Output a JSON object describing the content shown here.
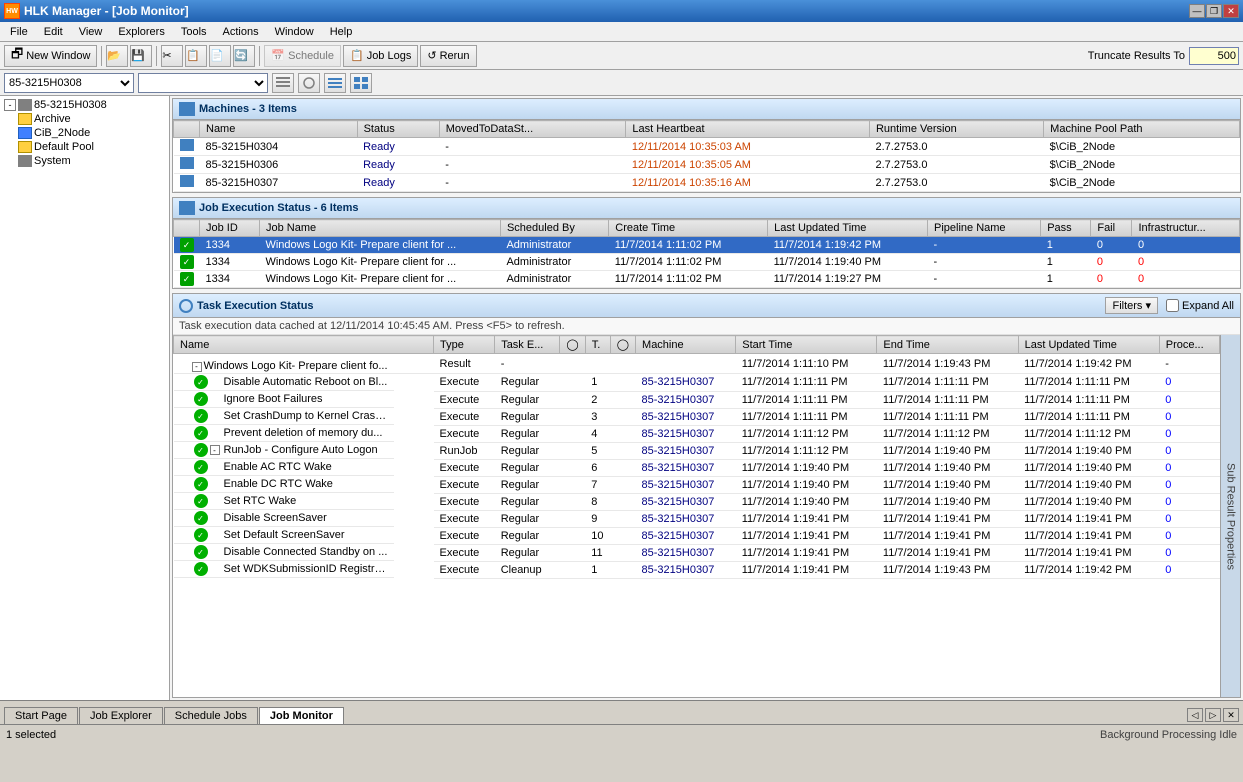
{
  "window": {
    "title": "HLK Manager - [Job Monitor]",
    "logo_text": "HW"
  },
  "title_buttons": [
    "—",
    "□",
    "✕"
  ],
  "menu": {
    "items": [
      "File",
      "Edit",
      "View",
      "Explorers",
      "Tools",
      "Actions",
      "Window",
      "Help"
    ]
  },
  "toolbar": {
    "new_window": "New Window",
    "schedule": "Schedule",
    "job_logs": "Job Logs",
    "rerun": "Rerun",
    "truncate_label": "Truncate Results To",
    "truncate_value": "500"
  },
  "addr_bar": {
    "machine_id": "85-3215H0308",
    "pool_value": ""
  },
  "sidebar": {
    "root_label": "85-3215H0308",
    "items": [
      {
        "label": "Archive",
        "type": "folder",
        "indent": 1
      },
      {
        "label": "CiB_2Node",
        "type": "folder-blue",
        "indent": 1
      },
      {
        "label": "Default Pool",
        "type": "folder",
        "indent": 1
      },
      {
        "label": "System",
        "type": "computer",
        "indent": 1
      }
    ]
  },
  "machines_section": {
    "title": "Machines - 3 Items",
    "columns": [
      "Name",
      "Status",
      "MovedToDataSt...",
      "Last Heartbeat",
      "Runtime Version",
      "Machine Pool Path"
    ],
    "rows": [
      {
        "name": "85-3215H0304",
        "status": "Ready",
        "moved": "-",
        "heartbeat": "12/11/2014 10:35:03 AM",
        "runtime": "2.7.2753.0",
        "pool_path": "$\\CiB_2Node"
      },
      {
        "name": "85-3215H0306",
        "status": "Ready",
        "moved": "-",
        "heartbeat": "12/11/2014 10:35:05 AM",
        "runtime": "2.7.2753.0",
        "pool_path": "$\\CiB_2Node"
      },
      {
        "name": "85-3215H0307",
        "status": "Ready",
        "moved": "-",
        "heartbeat": "12/11/2014 10:35:16 AM",
        "runtime": "2.7.2753.0",
        "pool_path": "$\\CiB_2Node"
      }
    ]
  },
  "jobs_section": {
    "title": "Job Execution Status - 6 Items",
    "columns": [
      "Job ID",
      "Job Name",
      "Scheduled By",
      "Create Time",
      "Last Updated Time",
      "Pipeline Name",
      "Pass",
      "Fail",
      "Infrastructur..."
    ],
    "rows": [
      {
        "selected": true,
        "id": "1334",
        "name": "Windows Logo Kit- Prepare client for ...",
        "scheduled_by": "Administrator",
        "create_time": "11/7/2014 1:11:02 PM",
        "updated_time": "11/7/2014 1:19:42 PM",
        "pipeline": "-",
        "pass": "1",
        "fail": "0",
        "infra": "0"
      },
      {
        "selected": false,
        "id": "1334",
        "name": "Windows Logo Kit- Prepare client for ...",
        "scheduled_by": "Administrator",
        "create_time": "11/7/2014 1:11:02 PM",
        "updated_time": "11/7/2014 1:19:40 PM",
        "pipeline": "-",
        "pass": "1",
        "fail": "0",
        "infra": "0"
      },
      {
        "selected": false,
        "id": "1334",
        "name": "Windows Logo Kit- Prepare client for ...",
        "scheduled_by": "Administrator",
        "create_time": "11/7/2014 1:11:02 PM",
        "updated_time": "11/7/2014 1:19:27 PM",
        "pipeline": "-",
        "pass": "1",
        "fail": "0",
        "infra": "0"
      }
    ]
  },
  "task_section": {
    "title": "Task Execution Status",
    "cache_info": "Task execution data cached at 12/11/2014 10:45:45 AM. Press <F5> to refresh.",
    "filters_label": "Filters ▾",
    "expand_all_label": "Expand All",
    "columns": [
      "Name",
      "Type",
      "Task E...",
      "◯",
      "T.",
      "◯",
      "Machine",
      "Start Time",
      "End Time",
      "Last Updated Time",
      "Proce..."
    ],
    "rows": [
      {
        "indent": 0,
        "expand": true,
        "icon": "folder",
        "name": "Windows Logo Kit- Prepare client fo...",
        "type": "Result",
        "task_e": "-",
        "col1": "",
        "t": "",
        "col2": "",
        "machine": "",
        "start": "11/7/2014 1:11:10 PM",
        "end": "11/7/2014 1:19:43 PM",
        "updated": "11/7/2014 1:19:42 PM",
        "proc": "-"
      },
      {
        "indent": 1,
        "icon": "green",
        "name": "Disable Automatic Reboot on Bl...",
        "type": "Execute",
        "task_e": "Regular",
        "col1": "",
        "t": "1",
        "col2": "",
        "machine": "85-3215H0307",
        "start": "11/7/2014 1:11:11 PM",
        "end": "11/7/2014 1:11:11 PM",
        "updated": "11/7/2014 1:11:11 PM",
        "proc": "0"
      },
      {
        "indent": 1,
        "icon": "green",
        "name": "Ignore Boot Failures",
        "type": "Execute",
        "task_e": "Regular",
        "col1": "",
        "t": "2",
        "col2": "",
        "machine": "85-3215H0307",
        "start": "11/7/2014 1:11:11 PM",
        "end": "11/7/2014 1:11:11 PM",
        "updated": "11/7/2014 1:11:11 PM",
        "proc": "0"
      },
      {
        "indent": 1,
        "icon": "green",
        "name": "Set CrashDump to Kernel Crash...",
        "type": "Execute",
        "task_e": "Regular",
        "col1": "",
        "t": "3",
        "col2": "",
        "machine": "85-3215H0307",
        "start": "11/7/2014 1:11:11 PM",
        "end": "11/7/2014 1:11:11 PM",
        "updated": "11/7/2014 1:11:11 PM",
        "proc": "0"
      },
      {
        "indent": 1,
        "icon": "green",
        "name": "Prevent deletion of memory du...",
        "type": "Execute",
        "task_e": "Regular",
        "col1": "",
        "t": "4",
        "col2": "",
        "machine": "85-3215H0307",
        "start": "11/7/2014 1:11:12 PM",
        "end": "11/7/2014 1:11:12 PM",
        "updated": "11/7/2014 1:11:12 PM",
        "proc": "0"
      },
      {
        "indent": 1,
        "icon": "green",
        "expand": true,
        "name": "RunJob - Configure Auto Logon",
        "type": "RunJob",
        "task_e": "Regular",
        "col1": "",
        "t": "5",
        "col2": "",
        "machine": "85-3215H0307",
        "start": "11/7/2014 1:11:12 PM",
        "end": "11/7/2014 1:19:40 PM",
        "updated": "11/7/2014 1:19:40 PM",
        "proc": "0"
      },
      {
        "indent": 1,
        "icon": "green",
        "name": "Enable AC RTC Wake",
        "type": "Execute",
        "task_e": "Regular",
        "col1": "",
        "t": "6",
        "col2": "",
        "machine": "85-3215H0307",
        "start": "11/7/2014 1:19:40 PM",
        "end": "11/7/2014 1:19:40 PM",
        "updated": "11/7/2014 1:19:40 PM",
        "proc": "0"
      },
      {
        "indent": 1,
        "icon": "green",
        "name": "Enable DC RTC Wake",
        "type": "Execute",
        "task_e": "Regular",
        "col1": "",
        "t": "7",
        "col2": "",
        "machine": "85-3215H0307",
        "start": "11/7/2014 1:19:40 PM",
        "end": "11/7/2014 1:19:40 PM",
        "updated": "11/7/2014 1:19:40 PM",
        "proc": "0"
      },
      {
        "indent": 1,
        "icon": "green",
        "name": "Set RTC Wake",
        "type": "Execute",
        "task_e": "Regular",
        "col1": "",
        "t": "8",
        "col2": "",
        "machine": "85-3215H0307",
        "start": "11/7/2014 1:19:40 PM",
        "end": "11/7/2014 1:19:40 PM",
        "updated": "11/7/2014 1:19:40 PM",
        "proc": "0"
      },
      {
        "indent": 1,
        "icon": "green",
        "name": "Disable ScreenSaver",
        "type": "Execute",
        "task_e": "Regular",
        "col1": "",
        "t": "9",
        "col2": "",
        "machine": "85-3215H0307",
        "start": "11/7/2014 1:19:41 PM",
        "end": "11/7/2014 1:19:41 PM",
        "updated": "11/7/2014 1:19:41 PM",
        "proc": "0"
      },
      {
        "indent": 1,
        "icon": "green",
        "name": "Set Default ScreenSaver",
        "type": "Execute",
        "task_e": "Regular",
        "col1": "",
        "t": "10",
        "col2": "",
        "machine": "85-3215H0307",
        "start": "11/7/2014 1:19:41 PM",
        "end": "11/7/2014 1:19:41 PM",
        "updated": "11/7/2014 1:19:41 PM",
        "proc": "0"
      },
      {
        "indent": 1,
        "icon": "green",
        "name": "Disable Connected Standby on ...",
        "type": "Execute",
        "task_e": "Regular",
        "col1": "",
        "t": "11",
        "col2": "",
        "machine": "85-3215H0307",
        "start": "11/7/2014 1:19:41 PM",
        "end": "11/7/2014 1:19:41 PM",
        "updated": "11/7/2014 1:19:41 PM",
        "proc": "0"
      },
      {
        "indent": 1,
        "icon": "green",
        "name": "Set WDKSubmissionID Registry...",
        "type": "Execute",
        "task_e": "Cleanup",
        "col1": "",
        "t": "1",
        "col2": "",
        "machine": "85-3215H0307",
        "start": "11/7/2014 1:19:41 PM",
        "end": "11/7/2014 1:19:43 PM",
        "updated": "11/7/2014 1:19:42 PM",
        "proc": "0"
      }
    ],
    "sub_result_label": "Sub Result Properties"
  },
  "tabs": {
    "items": [
      "Start Page",
      "Job Explorer",
      "Schedule Jobs",
      "Job Monitor"
    ],
    "active": "Job Monitor"
  },
  "status_bar": {
    "selected": "1 selected",
    "background": "Background Processing Idle"
  }
}
